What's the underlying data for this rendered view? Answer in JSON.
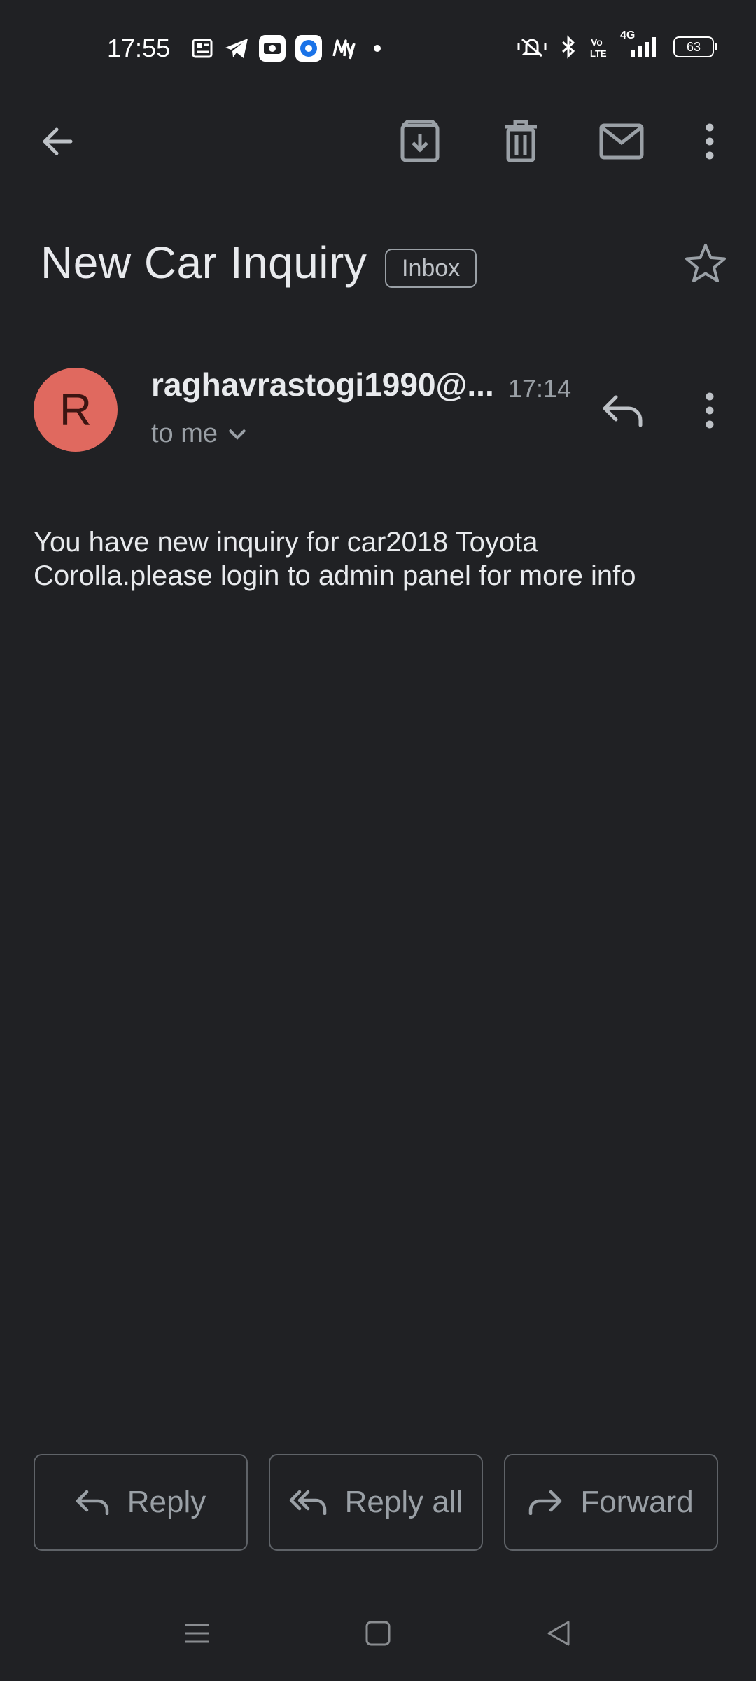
{
  "status_bar": {
    "time": "17:55",
    "battery": "63",
    "network": "4G",
    "left_icons": [
      "news-icon",
      "telegram-icon",
      "photos-app-icon",
      "browser-icon",
      "myntra-icon",
      "dot-icon"
    ],
    "right_icons": [
      "mute-icon",
      "bluetooth-icon",
      "volte-icon",
      "signal-icon",
      "battery-icon"
    ]
  },
  "toolbar": {
    "back": "back-arrow-icon",
    "archive": "archive-icon",
    "delete": "delete-icon",
    "mark_unread": "mail-icon",
    "more": "more-vert-icon"
  },
  "email": {
    "subject": "New Car Inquiry",
    "label": "Inbox",
    "sender_initial": "R",
    "sender": "raghavrastogi1990@...",
    "time": "17:14",
    "recipient": "to me",
    "body": "You have new inquiry for car2018 Toyota Corolla.please login to admin panel for more info"
  },
  "actions": {
    "reply": "Reply",
    "reply_all": "Reply all",
    "forward": "Forward"
  },
  "colors": {
    "background": "#202124",
    "avatar": "#e0695f",
    "text": "#e8eaed",
    "muted": "#9aa0a6"
  }
}
